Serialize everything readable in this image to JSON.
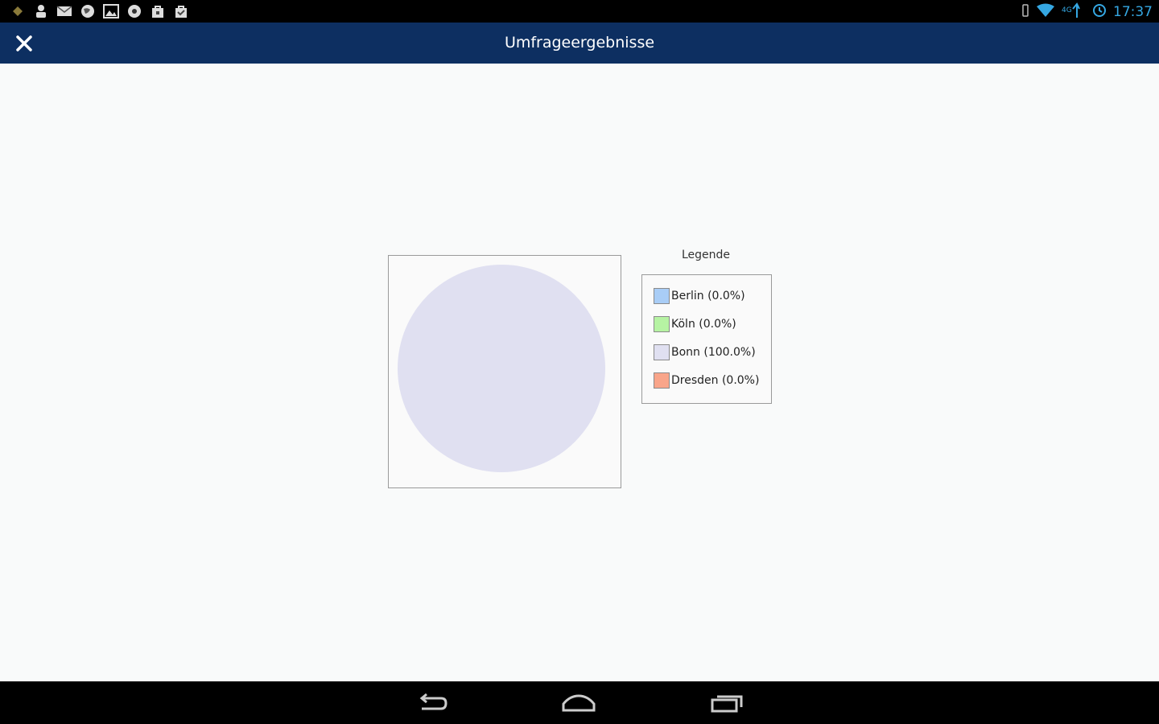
{
  "status_bar": {
    "time": "17:37",
    "left_icons": [
      "android-icon",
      "person-icon",
      "mail-icon",
      "globe-icon",
      "image-icon",
      "record-icon",
      "bag-icon",
      "briefcase-icon"
    ],
    "right_icons": [
      "vibrate-icon",
      "wifi-icon",
      "signal-icon",
      "sync-icon"
    ]
  },
  "header": {
    "title": "Umfrageergebnisse",
    "close_icon": "close-icon"
  },
  "chart_data": {
    "type": "pie",
    "categories": [
      "Berlin",
      "Köln",
      "Bonn",
      "Dresden"
    ],
    "values": [
      0.0,
      0.0,
      100.0,
      0.0
    ],
    "colors": [
      "#a9cdf6",
      "#b6f3a3",
      "#e0e0f1",
      "#f9a58a"
    ],
    "legend_title": "Legende",
    "legend_placement": "right",
    "legend_labels": [
      "Berlin (0.0%)",
      "Köln (0.0%)",
      "Bonn (100.0%)",
      "Dresden (0.0%)"
    ]
  },
  "nav_bar": {
    "icons": [
      "back-icon",
      "home-icon",
      "recent-apps-icon"
    ]
  }
}
